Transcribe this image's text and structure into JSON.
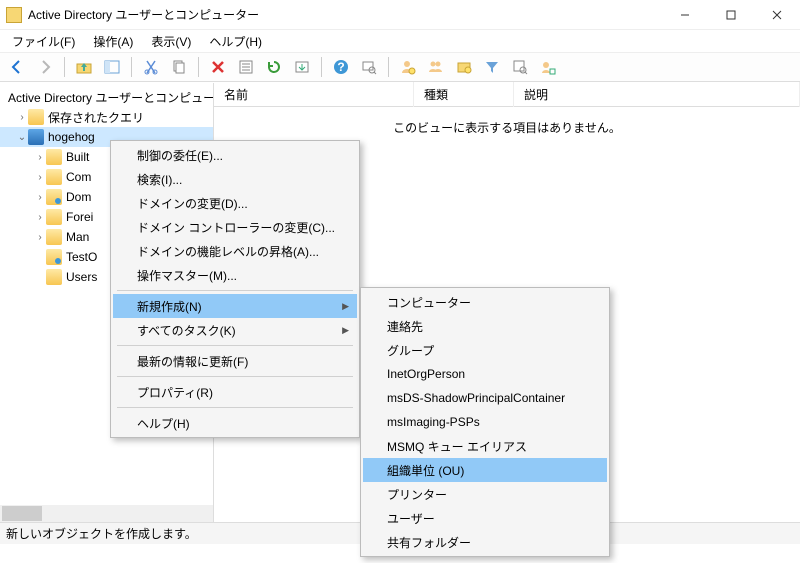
{
  "title": "Active Directory ユーザーとコンピューター",
  "menubar": {
    "file": "ファイル(F)",
    "action": "操作(A)",
    "view": "表示(V)",
    "help": "ヘルプ(H)"
  },
  "tree": {
    "root": "Active Directory ユーザーとコンピュータ",
    "saved_queries": "保存されたクエリ",
    "domain": "hogehog",
    "children": {
      "builtin": "Built",
      "computers": "Com",
      "domain_controllers": "Dom",
      "foreign": "Forei",
      "managed": "Man",
      "testou": "TestO",
      "users": "Users"
    }
  },
  "columns": {
    "name": "名前",
    "kind": "種類",
    "description": "説明"
  },
  "empty_message": "このビューに表示する項目はありません。",
  "context_menu": {
    "delegate": "制御の委任(E)...",
    "find": "検索(I)...",
    "change_domain": "ドメインの変更(D)...",
    "change_dc": "ドメイン コントローラーの変更(C)...",
    "raise_level": "ドメインの機能レベルの昇格(A)...",
    "operations_master": "操作マスター(M)...",
    "new": "新規作成(N)",
    "all_tasks": "すべてのタスク(K)",
    "refresh": "最新の情報に更新(F)",
    "properties": "プロパティ(R)",
    "help": "ヘルプ(H)"
  },
  "submenu_new": {
    "computer": "コンピューター",
    "contact": "連絡先",
    "group": "グループ",
    "inetorgperson": "InetOrgPerson",
    "msds": "msDS-ShadowPrincipalContainer",
    "msimaging": "msImaging-PSPs",
    "msmq": "MSMQ キュー エイリアス",
    "ou": "組織単位 (OU)",
    "printer": "プリンター",
    "user": "ユーザー",
    "shared_folder": "共有フォルダー"
  },
  "statusbar": "新しいオブジェクトを作成します。"
}
